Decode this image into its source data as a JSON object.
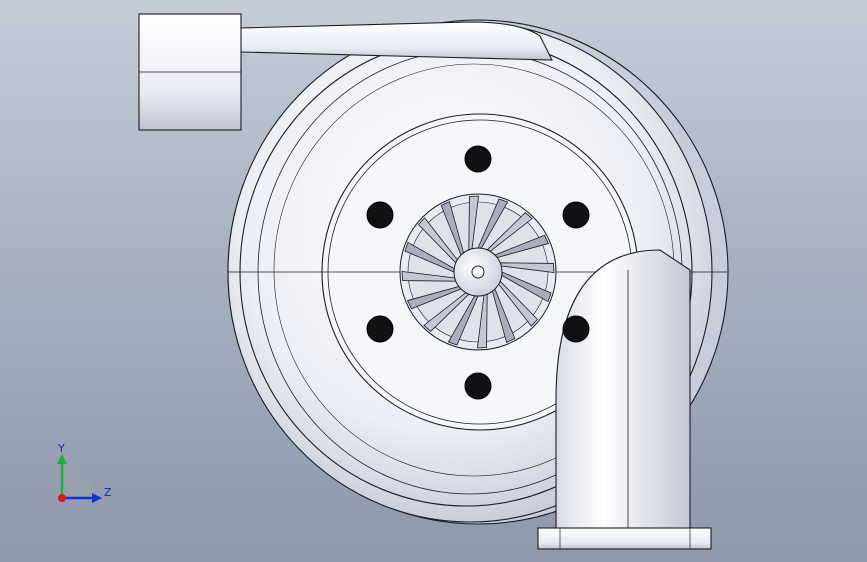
{
  "viewport": {
    "view": "front",
    "model": "turbocharger-compressor-housing",
    "bolt_holes": 6,
    "impeller_blades": 16,
    "colors": {
      "background_top": "#c6ccd8",
      "background_bottom": "#8e98ab",
      "part_fill": "#f2f3f8",
      "part_shadow": "#c9ccda",
      "edge": "#1c1c24",
      "hole": "#111114"
    }
  },
  "triad": {
    "y_label": "Y",
    "z_label": "Z",
    "colors": {
      "y": "#1fae3a",
      "z": "#1630d6",
      "x": "#d41b1b"
    }
  }
}
